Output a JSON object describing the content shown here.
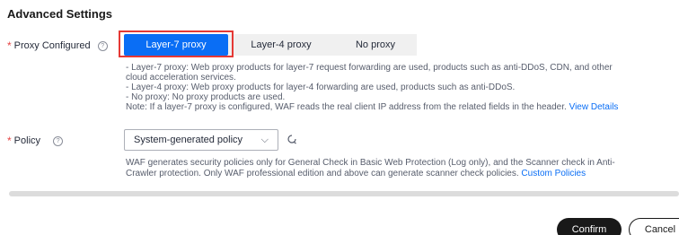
{
  "section_title": "Advanced Settings",
  "proxy": {
    "label": "Proxy Configured",
    "help_icon": "question-circle-icon",
    "options": [
      "Layer-7 proxy",
      "Layer-4 proxy",
      "No proxy"
    ],
    "selected": "Layer-7 proxy",
    "desc_lines": [
      "- Layer-7 proxy: Web proxy products for layer-7 request forwarding are used, products such as anti-DDoS, CDN, and other",
      "cloud acceleration services.",
      "- Layer-4 proxy: Web proxy products for layer-4 forwarding are used, products such as anti-DDoS.",
      "- No proxy: No proxy products are used."
    ],
    "note_text": "Note: If a layer-7 proxy is configured, WAF reads the real client IP address from the related fields in the header.",
    "note_link": "View Details"
  },
  "policy": {
    "label": "Policy",
    "help_icon": "question-circle-icon",
    "select_value": "System-generated policy",
    "refresh_icon": "refresh-icon",
    "desc_line1": "WAF generates security policies only for General Check in Basic Web Protection (Log only), and the Scanner check in Anti-",
    "desc_line2": "Crawler protection. Only WAF professional edition and above can generate scanner check policies.",
    "desc_link": "Custom Policies"
  },
  "footer": {
    "confirm_label": "Confirm",
    "cancel_label": "Cancel"
  },
  "colors": {
    "accent": "#0a6ef5",
    "required": "#e54545",
    "highlight_box": "#e53935",
    "confirm_bg": "#191919"
  }
}
